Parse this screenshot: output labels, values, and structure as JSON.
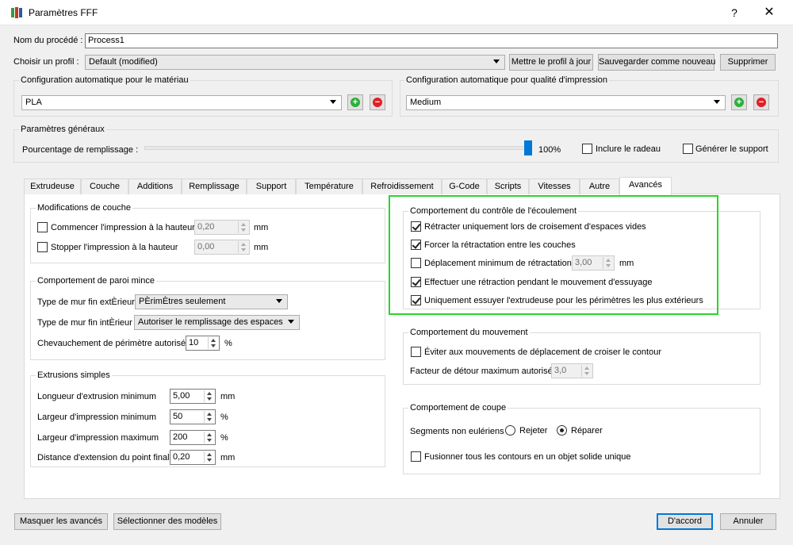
{
  "window": {
    "title": "Paramètres FFF",
    "help": "?",
    "close": "✕"
  },
  "process": {
    "label": "Nom du procédé :",
    "value": "Process1"
  },
  "profile": {
    "label": "Choisir un profil :",
    "value": "Default (modified)",
    "update_btn": "Mettre le profil à jour",
    "save_new_btn": "Sauvegarder comme nouveau",
    "delete_btn": "Supprimer"
  },
  "material": {
    "group_title": "Configuration automatique pour le matériau",
    "value": "PLA"
  },
  "quality": {
    "group_title": "Configuration automatique pour qualité d'impression",
    "value": "Medium"
  },
  "general": {
    "group_title": "Paramètres généraux",
    "infill_label": "Pourcentage de remplissage :",
    "infill_value": "100%",
    "infill_fraction": 1.0,
    "raft_label": "Inclure le radeau",
    "raft_checked": false,
    "support_label": "Générer le support",
    "support_checked": false
  },
  "tabs": [
    {
      "label": "Extrudeuse"
    },
    {
      "label": "Couche"
    },
    {
      "label": "Additions"
    },
    {
      "label": "Remplissage"
    },
    {
      "label": "Support"
    },
    {
      "label": "Température"
    },
    {
      "label": "Refroidissement"
    },
    {
      "label": "G-Code"
    },
    {
      "label": "Scripts"
    },
    {
      "label": "Vitesses"
    },
    {
      "label": "Autre"
    },
    {
      "label": "Avancés"
    }
  ],
  "active_tab": "Avancés",
  "layer_mods": {
    "group_title": "Modifications de couche",
    "start_label": "Commencer l'impression à la hauteur",
    "start_value": "0,20",
    "stop_label": "Stopper  l'impression à la hauteur",
    "stop_value": "0,00",
    "unit": "mm"
  },
  "thin_wall": {
    "group_title": "Comportement de paroi mince",
    "outer_label": "Type de mur fin extÈrieur",
    "outer_value": "PÈrimÈtres seulement",
    "inner_label": "Type de mur fin intÈrieur",
    "inner_value": "Autoriser le remplissage des espaces",
    "overlap_label": "Chevauchement de périmètre autorisé",
    "overlap_value": "10",
    "overlap_unit": "%"
  },
  "extrusions": {
    "group_title": "Extrusions simples",
    "rows": [
      {
        "label": "Longueur d'extrusion minimum",
        "value": "5,00",
        "unit": "mm"
      },
      {
        "label": "Largeur d'impression minimum",
        "value": "50",
        "unit": "%"
      },
      {
        "label": "Largeur d'impression maximum",
        "value": "200",
        "unit": "%"
      },
      {
        "label": "Distance d'extension du point final",
        "value": "0,20",
        "unit": "mm"
      }
    ]
  },
  "ooze": {
    "group_title": "Comportement du contrôle de l'écoulement",
    "retract_crossing": "Rétracter uniquement lors de croisement d'espaces vides",
    "force_retract": "Forcer la rétractation entre les couches",
    "min_travel": "Déplacement minimum de rétractation",
    "min_travel_value": "3,00",
    "min_travel_unit": "mm",
    "wipe_retract": "Effectuer une rétraction pendant le mouvement d'essuyage",
    "wipe_outer": "Uniquement essuyer l'extrudeuse pour les périmètres les plus extérieurs"
  },
  "movement": {
    "group_title": "Comportement du mouvement",
    "avoid_label": "Éviter aux mouvements de déplacement de croiser le contour",
    "detour_label": "Facteur de détour maximum autorisé",
    "detour_value": "3,0"
  },
  "slicing": {
    "group_title": "Comportement de coupe",
    "non_manifold_label": "Segments non eulériens :",
    "reject_label": "Rejeter",
    "repair_label": "Réparer",
    "merge_label": "Fusionner tous les contours en un objet solide unique"
  },
  "footer": {
    "hide_advanced": "Masquer les avancés",
    "select_models": "Sélectionner des modèles",
    "ok": "D'accord",
    "cancel": "Annuler"
  },
  "colors": {
    "accent": "#0078d7",
    "highlight": "#2bd42b",
    "add": "#2fae3b",
    "remove": "#e31e24"
  }
}
